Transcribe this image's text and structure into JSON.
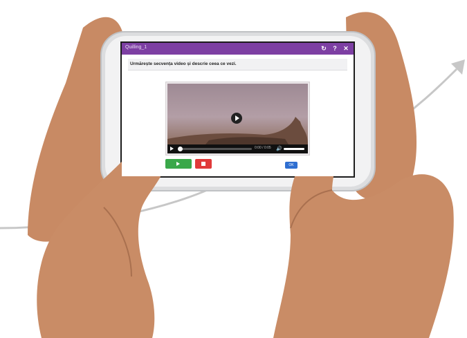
{
  "window": {
    "title": "Quilling_1"
  },
  "toolbar": {
    "settings_icon": "settings-icon",
    "help_icon": "help-icon",
    "close_icon": "close-icon"
  },
  "question": {
    "text": "Urmărește secvența video și descrie ceea ce vezi."
  },
  "player": {
    "time": "0:00 / 0:05",
    "progress": 0.0,
    "volume": 1.0
  },
  "buttons": {
    "play_icon": "play-icon",
    "stop_icon": "stop-icon",
    "ok_label": "OK"
  },
  "colors": {
    "titlebar": "#7d3fa3",
    "play_button": "#3aa84a",
    "stop_button": "#e03a3a",
    "ok_button": "#2f6fd1"
  }
}
